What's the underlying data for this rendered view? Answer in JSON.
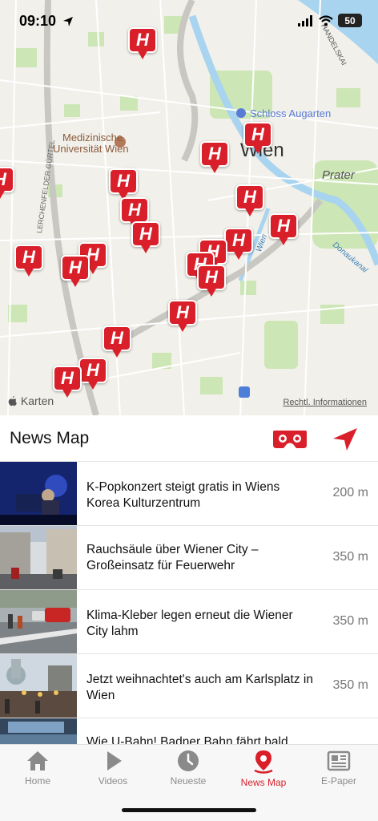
{
  "status": {
    "time": "09:10",
    "battery": "50"
  },
  "map": {
    "labels": {
      "schloss": "Schloss Augarten",
      "uni_line1": "Medizinische",
      "uni_line2": "Universität Wien",
      "wien": "Wien",
      "prater": "Prater",
      "lerchenfelder": "LERCHENFELDER GÜRTEL",
      "handelskai": "HANDELSKAI",
      "donaukanal": "Donaukanal",
      "wien_river": "Wien"
    },
    "pin_letter": "H",
    "attribution": "Karten",
    "legal": "Rechtl. Informationen"
  },
  "header": {
    "title": "News Map"
  },
  "articles": [
    {
      "title": "K-Popkonzert steigt gratis in Wiens Korea Kulturzentrum",
      "distance": "200 m"
    },
    {
      "title": "Rauchsäule über Wiener City – Großeinsatz für Feuerwehr",
      "distance": "350 m"
    },
    {
      "title": "Klima-Kleber legen erneut die Wiener City lahm",
      "distance": "350 m"
    },
    {
      "title": "Jetzt weihnachtet's auch am Karlsplatz in Wien",
      "distance": "350 m"
    },
    {
      "title": "Wie U-Bahn! Badner Bahn fährt bald",
      "distance": ""
    }
  ],
  "tabs": [
    {
      "label": "Home",
      "icon": "home-icon"
    },
    {
      "label": "Videos",
      "icon": "play-icon"
    },
    {
      "label": "Neueste",
      "icon": "clock-icon"
    },
    {
      "label": "News Map",
      "icon": "map-pin-icon"
    },
    {
      "label": "E-Paper",
      "icon": "newspaper-icon"
    }
  ],
  "colors": {
    "accent": "#d9202a"
  }
}
